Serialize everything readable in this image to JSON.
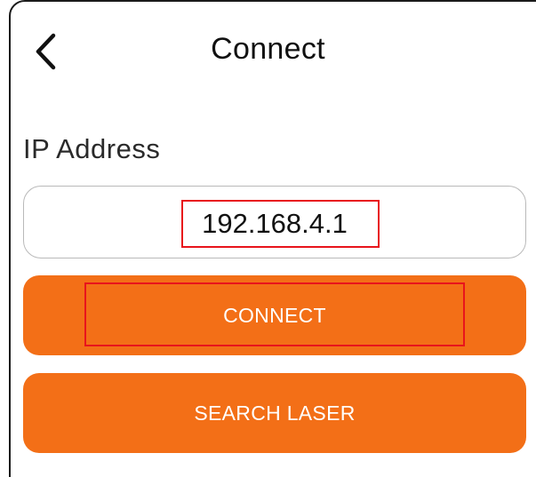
{
  "header": {
    "back_icon": "chevron-left-icon",
    "title": "Connect"
  },
  "form": {
    "ip_label": "IP Address",
    "ip_value": "192.168.4.1"
  },
  "actions": {
    "connect_label": "CONNECT",
    "search_label": "SEARCH LASER"
  },
  "colors": {
    "accent": "#f36f17",
    "highlight": "#e8141c",
    "field_border": "#b9b9b9"
  }
}
